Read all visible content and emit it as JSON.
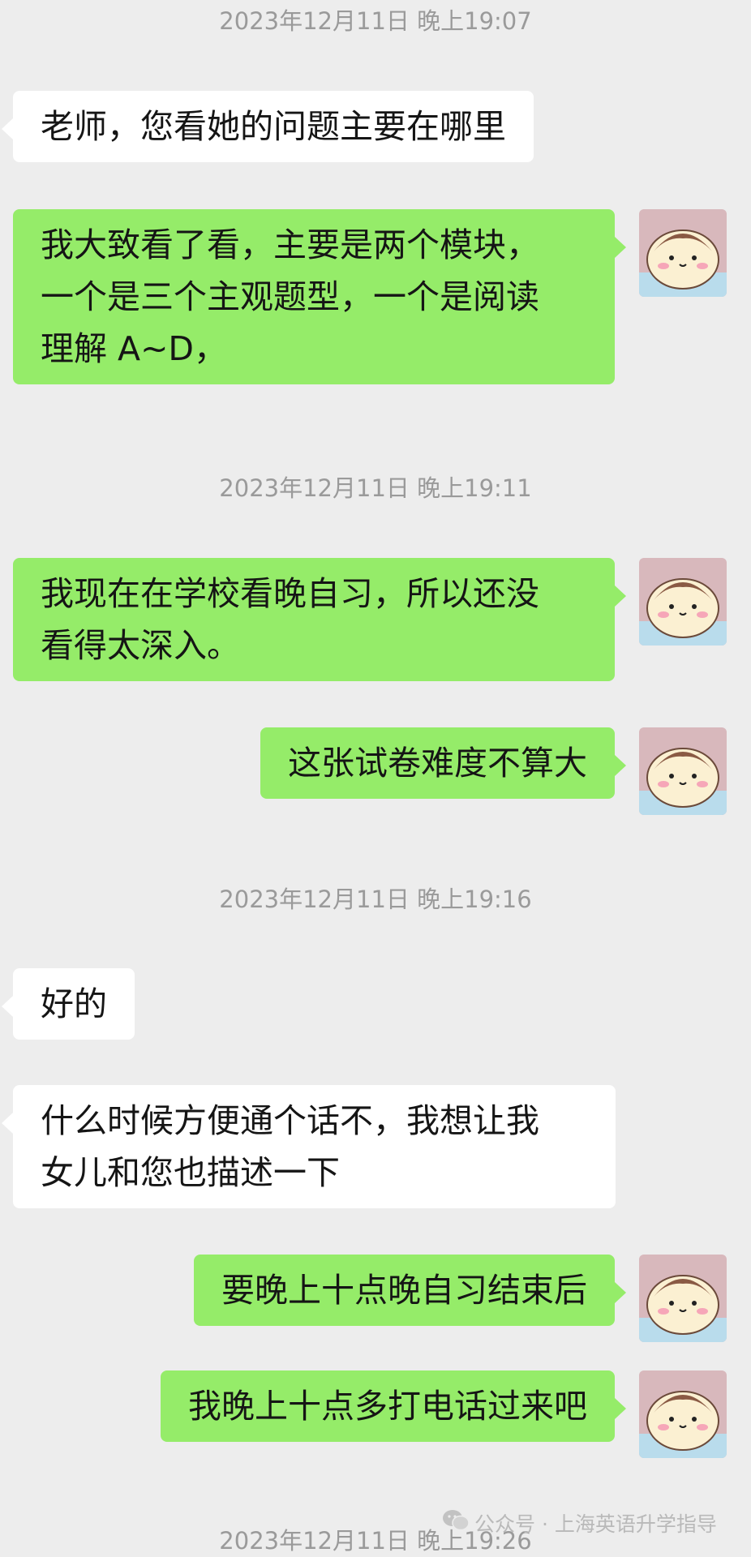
{
  "timestamps": [
    "2023年12月11日 晚上19:07",
    "2023年12月11日 晚上19:11",
    "2023年12月11日 晚上19:16",
    "2023年12月11日 晚上19:26"
  ],
  "messages": [
    {
      "side": "received",
      "lines": [
        "老师，您看她的问题主要在哪里"
      ]
    },
    {
      "side": "sent",
      "lines": [
        "我大致看了看，主要是两个模块，",
        "一个是三个主观题型，一个是阅读",
        "理解 A~D，"
      ]
    },
    {
      "side": "sent",
      "lines": [
        "我现在在学校看晚自习，所以还没",
        "看得太深入。"
      ]
    },
    {
      "side": "sent",
      "lines": [
        "这张试卷难度不算大"
      ]
    },
    {
      "side": "received",
      "lines": [
        "好的"
      ]
    },
    {
      "side": "received",
      "lines": [
        "什么时候方便通个话不，我想让我",
        "女儿和您也描述一下"
      ]
    },
    {
      "side": "sent",
      "lines": [
        "要晚上十点晚自习结束后"
      ]
    },
    {
      "side": "sent",
      "lines": [
        "我晚上十点多打电话过来吧"
      ]
    }
  ],
  "watermark": "公众号 · 上海英语升学指导",
  "colors": {
    "background": "#ededed",
    "sent_bubble": "#95ec69",
    "received_bubble": "#ffffff",
    "timestamp_text": "#9a9a9a"
  },
  "icons": {
    "avatar": "hamster-avatar-icon",
    "watermark": "wechat-icon"
  }
}
